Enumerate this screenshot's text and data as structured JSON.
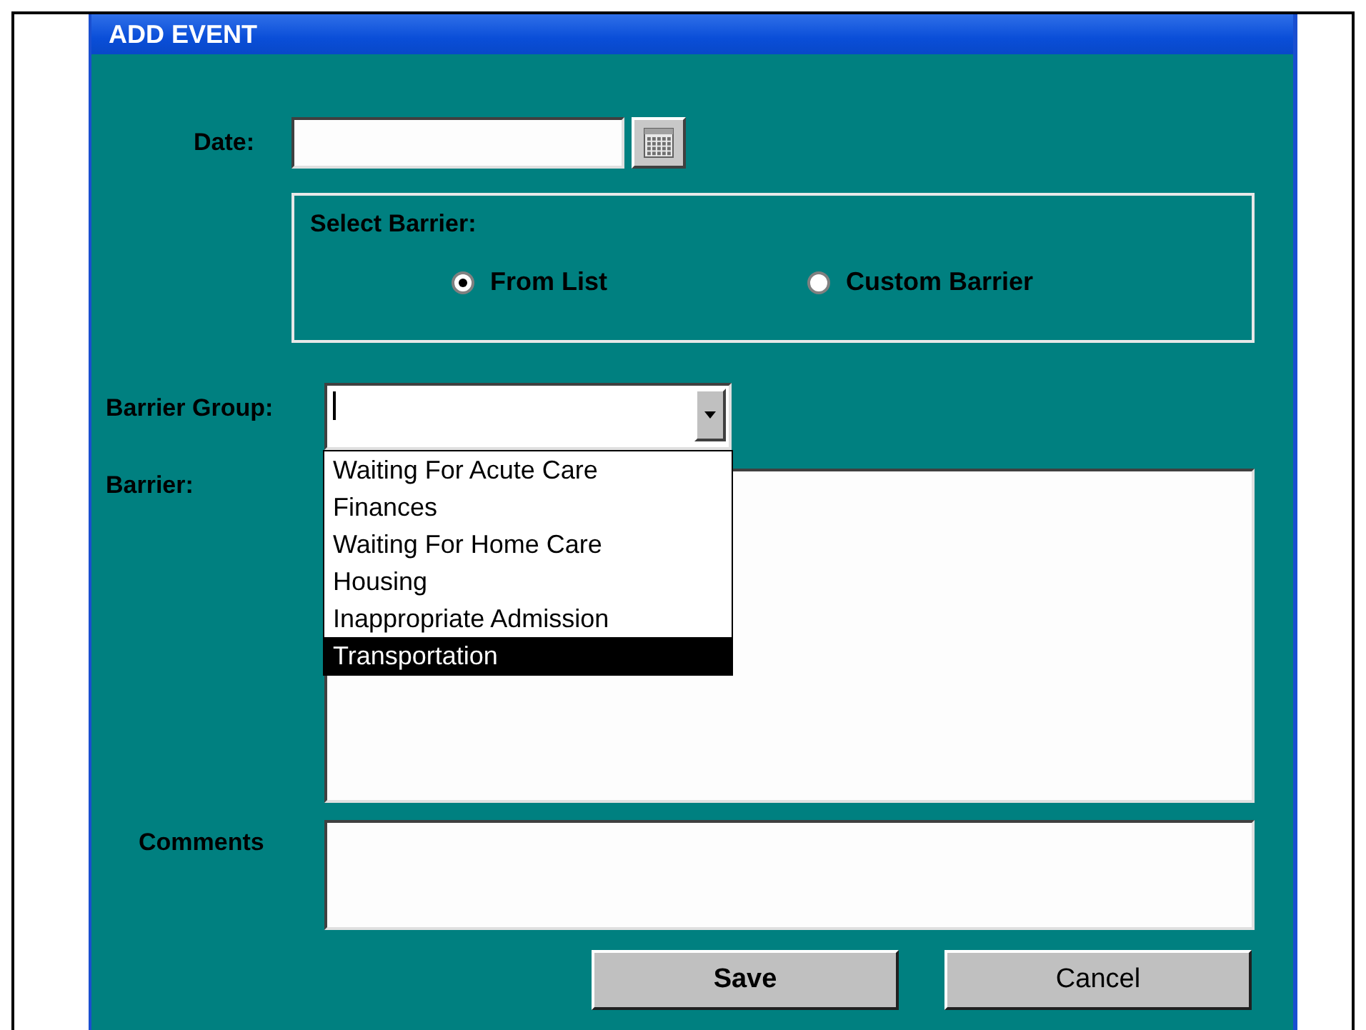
{
  "window": {
    "title": "ADD EVENT"
  },
  "date": {
    "label": "Date:"
  },
  "select_barrier": {
    "legend": "Select Barrier:",
    "options": [
      {
        "label": "From List",
        "selected": true
      },
      {
        "label": "Custom Barrier",
        "selected": false
      }
    ]
  },
  "barrier_group": {
    "label": "Barrier Group:",
    "expanded": true,
    "options": [
      {
        "label": "Waiting For Acute Care",
        "selected": false
      },
      {
        "label": "Finances",
        "selected": false
      },
      {
        "label": "Waiting For Home Care",
        "selected": false
      },
      {
        "label": "Housing",
        "selected": false
      },
      {
        "label": "Inappropriate Admission",
        "selected": false
      },
      {
        "label": "Transportation",
        "selected": true
      }
    ]
  },
  "barrier": {
    "label": "Barrier:"
  },
  "comments": {
    "label": "Comments"
  },
  "buttons": [
    {
      "label": "Save",
      "kind": "primary"
    },
    {
      "label": "Cancel",
      "kind": "normal"
    }
  ]
}
